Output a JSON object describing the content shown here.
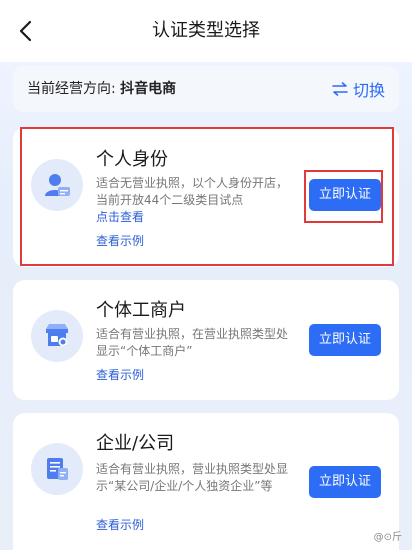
{
  "header": {
    "title": "认证类型选择"
  },
  "direction": {
    "label": "当前经营方向: ",
    "value": "抖音电商",
    "switch_label": "切换"
  },
  "cards": [
    {
      "title": "个人身份",
      "desc": "适合无营业执照，以个人身份开店，当前开放44个二级类目试点",
      "inline_link": "点击查看",
      "example_link": "查看示例",
      "button": "立即认证",
      "icon": "person-icon"
    },
    {
      "title": "个体工商户",
      "desc": "适合有营业执照，在营业执照类型处显示“个体工商户”",
      "example_link": "查看示例",
      "button": "立即认证",
      "icon": "shop-icon"
    },
    {
      "title": "企业/公司",
      "desc": "适合有营业执照，营业执照类型处显示“某公司/企业/个人独资企业”等",
      "example_link": "查看示例",
      "button": "立即认证",
      "icon": "document-icon"
    }
  ],
  "watermark": "@⊙斤",
  "colors": {
    "accent": "#2d6cf5",
    "highlight": "#e03a3a"
  }
}
